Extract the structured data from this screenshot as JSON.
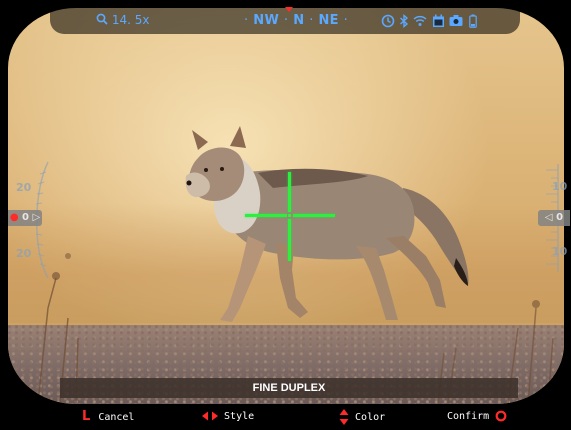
{
  "status_bar": {
    "zoom_label": "14. 5x",
    "compass": [
      "NW",
      "N",
      "NE"
    ],
    "icons": [
      "search-icon",
      "timer-icon",
      "bluetooth-icon",
      "wifi-icon",
      "calendar-icon",
      "camera-icon",
      "battery-icon"
    ]
  },
  "left_scale": {
    "top_label": "20",
    "center_label": "0",
    "bottom_label": "20"
  },
  "right_scale": {
    "top_label": "10",
    "center_label": "0",
    "bottom_label": "10"
  },
  "reticle": {
    "style_name": "FINE DUPLEX",
    "color": "#2cf03d"
  },
  "bottom_bar": {
    "cancel_key": "L",
    "cancel_label": "Cancel",
    "style_label": "Style",
    "color_label": "Color",
    "confirm_label": "Confirm"
  },
  "colors": {
    "accent_blue": "#5aa8ff",
    "accent_red": "#ff2a2a",
    "reticle_green": "#2cf03d"
  }
}
